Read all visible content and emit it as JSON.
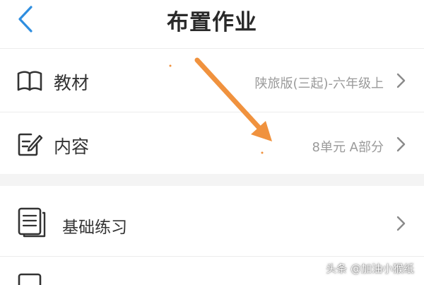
{
  "header": {
    "title": "布置作业"
  },
  "rows": [
    {
      "label": "教材",
      "value": "陕旅版(三起)-六年级上"
    },
    {
      "label": "内容",
      "value": "8单元 A部分"
    },
    {
      "label": "基础练习",
      "value": ""
    }
  ],
  "watermark": {
    "text": "头条 @加油小猴纸"
  },
  "icons": {
    "back": "chevron-left-icon",
    "textbook": "book-icon",
    "content": "edit-document-icon",
    "basic_practice": "document-list-icon",
    "row_arrow": "chevron-right-icon"
  },
  "colors": {
    "accent": "#2f8ee0",
    "annotation_arrow": "#f0923e",
    "value_text": "#9a9a9a",
    "section_gap": "#f4f4f4"
  }
}
